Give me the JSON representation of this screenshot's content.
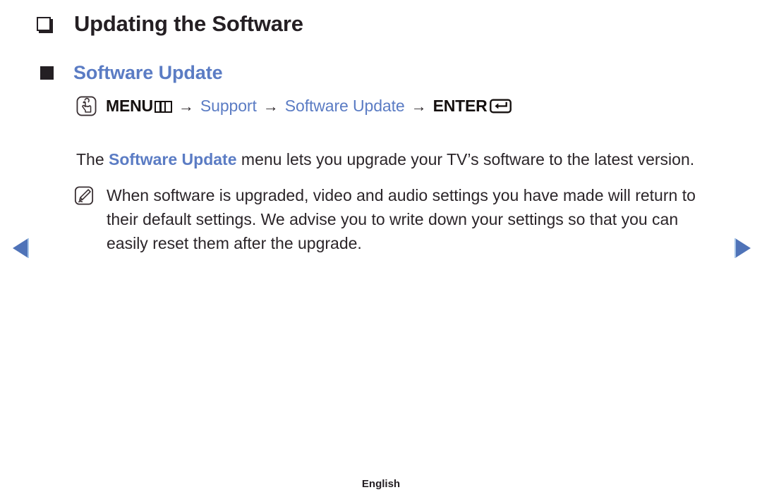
{
  "page": {
    "title": "Updating the Software",
    "section_heading": "Software Update",
    "footer_language": "English"
  },
  "menu_path": {
    "icon": "press-button-icon",
    "menu_label": "MENU",
    "menu_glyph": "menu-grid-glyph",
    "arrow": "→",
    "support_label": "Support",
    "software_update_label": "Software Update",
    "enter_label": "ENTER",
    "enter_glyph": "enter-return-glyph"
  },
  "body": {
    "lead": "The ",
    "highlight": "Software Update",
    "rest": " menu lets you upgrade your TV’s software to the latest version."
  },
  "note": {
    "icon": "note-pencil-icon",
    "text": "When software is upgraded, video and audio settings you have made will return to their default settings. We advise you to write down your settings so that you can easily reset them after the upgrade."
  },
  "navigation": {
    "prev_icon": "triangle-left-icon",
    "next_icon": "triangle-right-icon"
  },
  "colors": {
    "accent_blue": "#5b7cc4",
    "text_dark": "#2b2529",
    "background": "#ffffff"
  }
}
